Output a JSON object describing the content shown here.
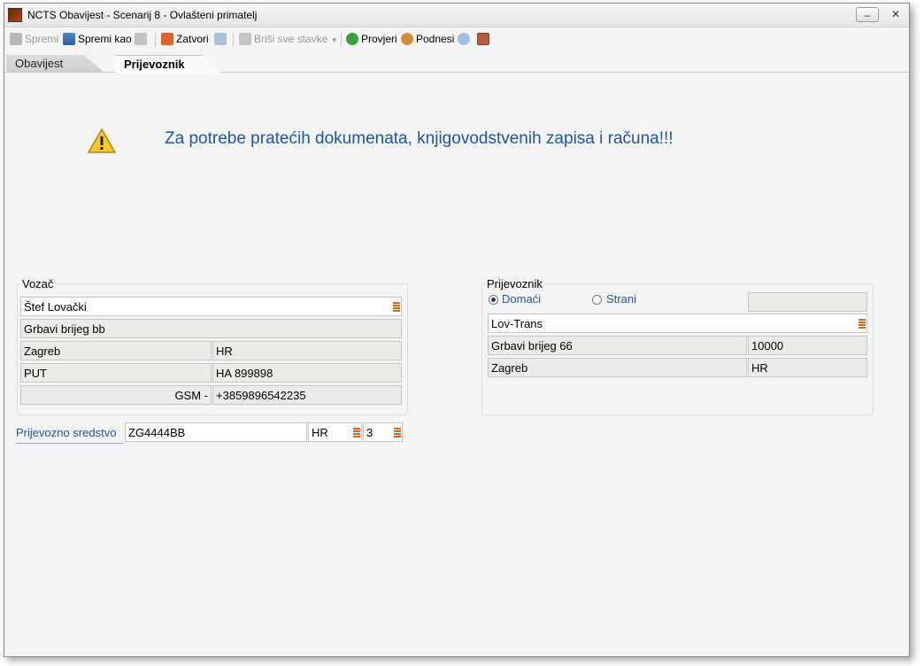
{
  "window": {
    "title": "NCTS Obavijest - Scenarij 8 - Ovlašteni primatelj",
    "minimize": "–",
    "close": "✕"
  },
  "toolbar": {
    "spremi": "Spremi",
    "spremi_kao": "Spremi kao",
    "zatvori": "Zatvori",
    "brisi": "Briši sve stavke",
    "provjeri": "Provjeri",
    "podnesi": "Podnesi"
  },
  "tabs": [
    {
      "label": "Obavijest"
    },
    {
      "label": "Prijevoznik"
    }
  ],
  "warning": {
    "text": "Za potrebe pratećih dokumenata, knjigovodstvenih zapisa i računa!!!"
  },
  "vozac": {
    "legend": "Vozač",
    "name": "Štef Lovački",
    "address": "Grbavi brijeg bb",
    "city": "Zagreb",
    "country": "HR",
    "doc_type": "PUT",
    "doc_number": "HA 899898",
    "phone_label": "GSM -",
    "phone": "+3859896542235"
  },
  "prijevozno": {
    "label": "Prijevozno sredstvo",
    "reg": "ZG4444BB",
    "country": "HR",
    "code": "3"
  },
  "prijevoznik": {
    "legend": "Prijevoznik",
    "domaci": "Domaći",
    "strani": "Strani",
    "name": "Lov-Trans",
    "address": "Grbavi brijeg 66",
    "postal": "10000",
    "city": "Zagreb",
    "country": "HR"
  },
  "colors": {
    "accent": "#1f57a0",
    "field_bg": "#ecebe8"
  }
}
